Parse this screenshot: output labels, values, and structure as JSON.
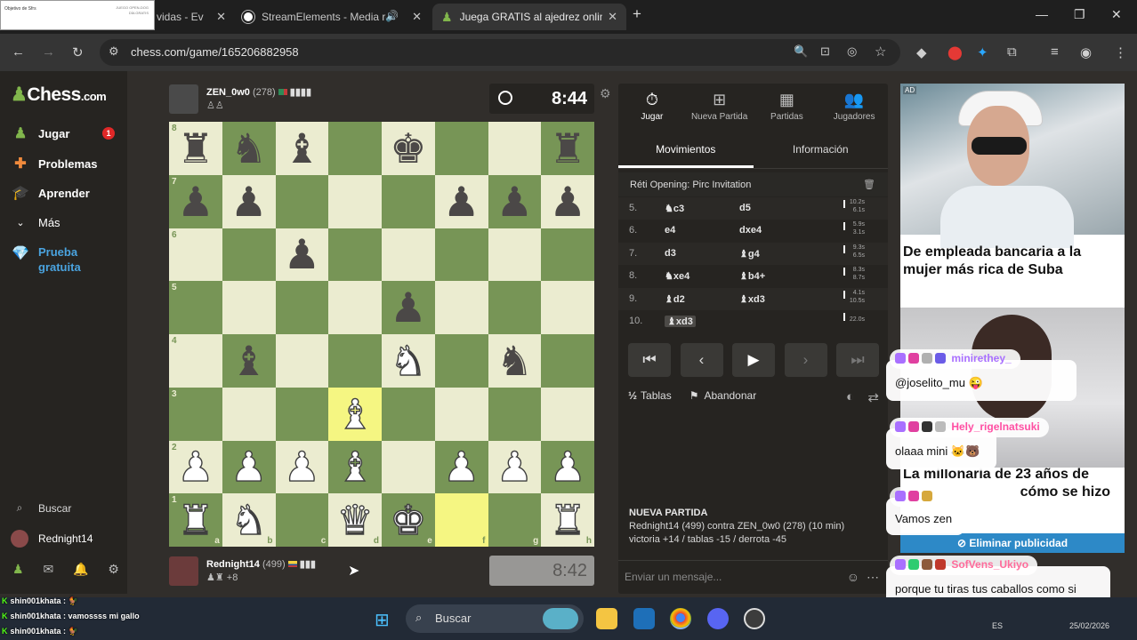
{
  "browser": {
    "tabs": [
      {
        "title": "vidas - Ev"
      },
      {
        "title": "StreamElements - Media re"
      },
      {
        "title": "Juega GRATIS al ajedrez online"
      }
    ],
    "thumb_text": "Objetivo de Sfrs",
    "thumb_right1": "JUEGO OPEN-DOG",
    "thumb_right2": "DÍA GRATIS",
    "url": "chess.com/game/165206882958",
    "new_tab": "+",
    "close": "✕"
  },
  "sidebar": {
    "logo_main": "Chess",
    "logo_suffix": ".com",
    "items": [
      {
        "label": "Jugar",
        "icon": "play-pawn-icon",
        "badge": "1"
      },
      {
        "label": "Problemas",
        "icon": "puzzle-icon"
      },
      {
        "label": "Aprender",
        "icon": "graduation-icon"
      },
      {
        "label": "Más",
        "icon": "chevron-down-icon"
      },
      {
        "label": "Prueba gratuita",
        "icon": "diamond-icon"
      }
    ],
    "search_label": "Buscar",
    "user": "Rednight14"
  },
  "top_player": {
    "name": "ZEN_0w0",
    "rating": "(278)",
    "clock": "8:44",
    "flag_color": "#c23b3b"
  },
  "bottom_player": {
    "name": "Rednight14",
    "rating": "(499)",
    "clock": "8:42",
    "captured_extra": "+8",
    "flag_color": "#f4d03f"
  },
  "board": {
    "squares": [
      [
        "br",
        "bn",
        "bb",
        "",
        "bk",
        "",
        "",
        "br"
      ],
      [
        "bp",
        "bp",
        "",
        "",
        "",
        "bp",
        "bp",
        "bp"
      ],
      [
        "",
        "",
        "bp",
        "",
        "",
        "",
        "",
        ""
      ],
      [
        "",
        "",
        "",
        "",
        "bp",
        "",
        "",
        ""
      ],
      [
        "",
        "bb",
        "",
        "",
        "wn",
        "",
        "bn",
        ""
      ],
      [
        "",
        "",
        "",
        "wb",
        "",
        "",
        "",
        ""
      ],
      [
        "wp",
        "wp",
        "wp",
        "wb",
        "",
        "wp",
        "wp",
        "wp"
      ],
      [
        "wr",
        "wn",
        "",
        "wq",
        "wk",
        "",
        "",
        "wr"
      ]
    ],
    "highlights": [
      "d3",
      "f1"
    ],
    "rank_labels": [
      "8",
      "7",
      "6",
      "5",
      "4",
      "3",
      "2",
      "1"
    ],
    "file_labels": [
      "a",
      "b",
      "c",
      "d",
      "e",
      "f",
      "g",
      "h"
    ]
  },
  "panel": {
    "tabs": [
      {
        "label": "Jugar",
        "icon": "stopwatch-icon"
      },
      {
        "label": "Nueva Partida",
        "icon": "plus-square-icon"
      },
      {
        "label": "Partidas",
        "icon": "board-icon"
      },
      {
        "label": "Jugadores",
        "icon": "people-icon"
      }
    ],
    "subtabs": [
      "Movimientos",
      "Información"
    ],
    "opening": "Réti Opening: Pirc Invitation",
    "moves": [
      {
        "num": "5.",
        "white": "♞c3",
        "black": "d5",
        "wt": "10.2s",
        "bt": "6.1s"
      },
      {
        "num": "6.",
        "white": "e4",
        "black": "dxe4",
        "wt": "5.9s",
        "bt": "3.1s"
      },
      {
        "num": "7.",
        "white": "d3",
        "black": "♝g4",
        "wt": "9.3s",
        "bt": "6.5s"
      },
      {
        "num": "8.",
        "white": "♞xe4",
        "black": "♝b4+",
        "wt": "8.3s",
        "bt": "8.7s"
      },
      {
        "num": "9.",
        "white": "♝d2",
        "black": "♝xd3",
        "wt": "4.1s",
        "bt": "10.5s"
      },
      {
        "num": "10.",
        "white": "♝xd3",
        "black": "",
        "wt": "22.0s",
        "bt": ""
      }
    ],
    "tablas": "Tablas",
    "abandonar": "Abandonar",
    "game_heading": "NUEVA PARTIDA",
    "game_line1": "Rednight14 (499) contra ZEN_0w0 (278) (10 min)",
    "game_line2": "victoria +14 / tablas -15 / derrota -45",
    "message_placeholder": "Enviar un mensaje..."
  },
  "ad": {
    "label": "AD",
    "title1": "De empleada bancaria a la mujer más rica de Suba",
    "title2": "La millonaria de 23 años de",
    "title2b": "cómo se hizo",
    "remove": "Eliminar publicidad"
  },
  "chat": [
    {
      "user": "minirethey_",
      "text": "@joselito_mu 😜",
      "color": "#a970ff"
    },
    {
      "user": "Hely_rigelnatsuki",
      "text": "olaaa mini 🐱🐻",
      "color": "#ff4fa3"
    },
    {
      "user": "",
      "text": "Vamos zen",
      "color": "#49d89b"
    },
    {
      "user": "SofVens_Ukiyo",
      "text": "porque tu tiras tus caballos como si fueran verga",
      "color": "#ff6b9b"
    }
  ],
  "kick_chat": [
    {
      "user": "shin001khata",
      "text": ""
    },
    {
      "user": "shin001khata",
      "text": "vamossss mi gallo"
    },
    {
      "user": "shin001khata",
      "text": ""
    }
  ],
  "taskbar": {
    "search": "Buscar",
    "lang": "ES",
    "date": "25/02/2026"
  }
}
